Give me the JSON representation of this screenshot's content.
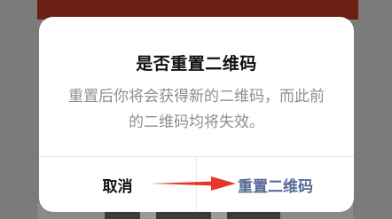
{
  "dialog": {
    "title": "是否重置二维码",
    "message": "重置后你将会获得新的二维码，而此前的二维码均将失效。",
    "cancel_label": "取消",
    "confirm_label": "重置二维码"
  },
  "colors": {
    "confirm_text": "#576b95",
    "annotation_arrow": "#e8362b",
    "overlay": "#7b7b7b"
  },
  "annotation": {
    "icon": "red-arrow-icon"
  }
}
